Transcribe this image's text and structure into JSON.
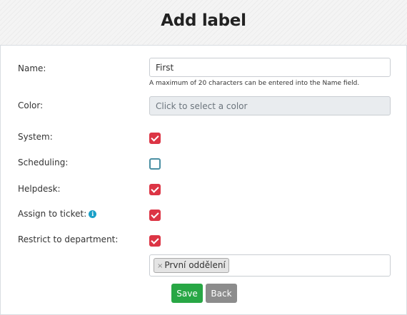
{
  "page": {
    "title": "Add label"
  },
  "form": {
    "name": {
      "label": "Name:",
      "value": "First",
      "hint": "A maximum of 20 characters can be entered into the Name field."
    },
    "color": {
      "label": "Color:",
      "placeholder": "Click to select a color"
    },
    "system": {
      "label": "System:",
      "checked": true
    },
    "scheduling": {
      "label": "Scheduling:",
      "checked": false
    },
    "helpdesk": {
      "label": "Helpdesk:",
      "checked": true
    },
    "assign_to_ticket": {
      "label": "Assign to ticket:",
      "checked": true,
      "icon": "info-icon"
    },
    "restrict_to_department": {
      "label": "Restrict to department:",
      "checked": true
    },
    "departments": {
      "selected": [
        "První oddělení"
      ],
      "remove_symbol": "×"
    }
  },
  "buttons": {
    "save": "Save",
    "back": "Back"
  },
  "colors": {
    "checkbox_checked": "#dc3545",
    "save_button": "#28a745",
    "back_button": "#8c8c8c",
    "info_icon": "#1aa0c8"
  }
}
